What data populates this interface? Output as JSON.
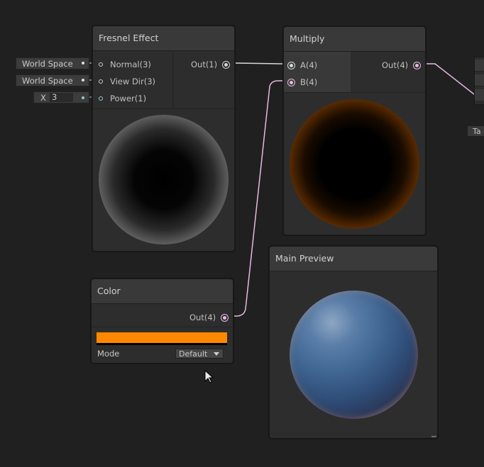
{
  "fresnel": {
    "title": "Fresnel Effect",
    "inputs": [
      "Normal(3)",
      "View Dir(3)",
      "Power(1)"
    ],
    "output": "Out(1)",
    "defaults": [
      "World Space",
      "World Space"
    ],
    "power": {
      "label": "X",
      "value": "3"
    }
  },
  "multiply": {
    "title": "Multiply",
    "inputs": [
      "A(4)",
      "B(4)"
    ],
    "output": "Out(4)"
  },
  "color_node": {
    "title": "Color",
    "output": "Out(4)",
    "swatch": "#ff8800",
    "mode_label": "Mode",
    "mode_value": "Default"
  },
  "main_preview": {
    "title": "Main Preview"
  },
  "offscreen_tab": "Ta"
}
